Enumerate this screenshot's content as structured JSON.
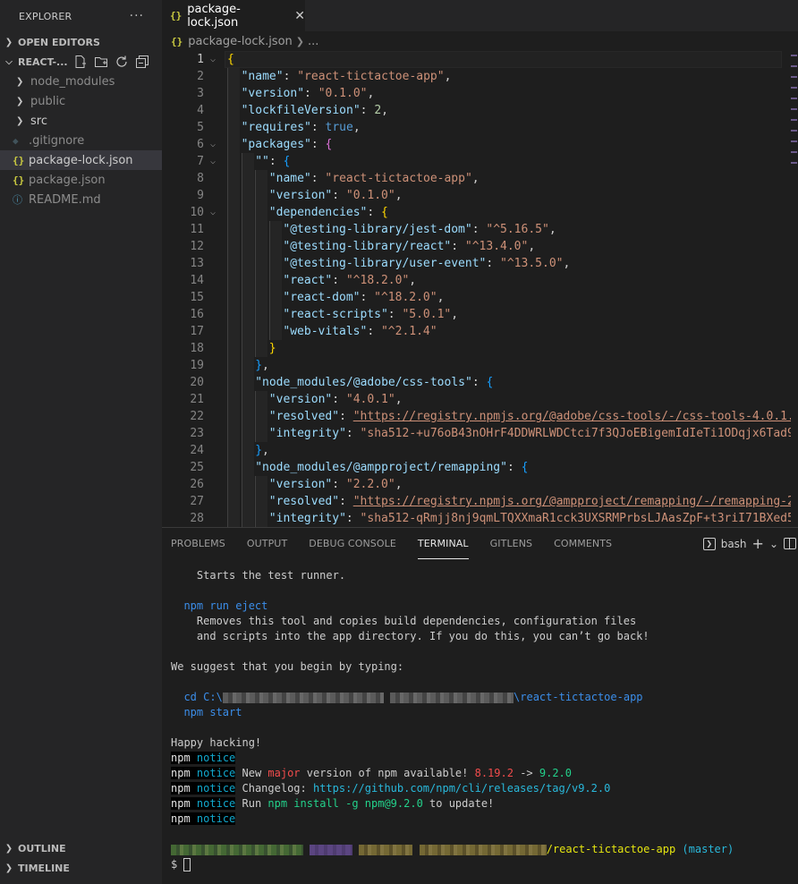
{
  "explorer": {
    "title": "EXPLORER",
    "more": "···",
    "open_editors": "OPEN EDITORS",
    "project": "REACT-...",
    "items": [
      {
        "label": "node_modules",
        "type": "folder"
      },
      {
        "label": "public",
        "type": "folder"
      },
      {
        "label": "src",
        "type": "folder"
      },
      {
        "label": ".gitignore",
        "type": "git"
      },
      {
        "label": "package-lock.json",
        "type": "json"
      },
      {
        "label": "package.json",
        "type": "json"
      },
      {
        "label": "README.md",
        "type": "info"
      }
    ],
    "outline": "OUTLINE",
    "timeline": "TIMELINE"
  },
  "editor": {
    "tab_label": "package-lock.json",
    "json_icon": "{}",
    "close_icon": "✕",
    "breadcrumb_file": "package-lock.json",
    "breadcrumb_more": "..."
  },
  "code_lines": [
    [
      [
        "p1",
        "{"
      ]
    ],
    [
      [
        "k",
        "\"name\""
      ],
      [
        "t",
        ": "
      ],
      [
        "s",
        "\"react-tictactoe-app\""
      ],
      [
        "t",
        ","
      ]
    ],
    [
      [
        "k",
        "\"version\""
      ],
      [
        "t",
        ": "
      ],
      [
        "s",
        "\"0.1.0\""
      ],
      [
        "t",
        ","
      ]
    ],
    [
      [
        "k",
        "\"lockfileVersion\""
      ],
      [
        "t",
        ": "
      ],
      [
        "n",
        "2"
      ],
      [
        "t",
        ","
      ]
    ],
    [
      [
        "k",
        "\"requires\""
      ],
      [
        "t",
        ": "
      ],
      [
        "b",
        "true"
      ],
      [
        "t",
        ","
      ]
    ],
    [
      [
        "k",
        "\"packages\""
      ],
      [
        "t",
        ": "
      ],
      [
        "p2",
        "{"
      ]
    ],
    [
      [
        "k",
        "\"\""
      ],
      [
        "t",
        ": "
      ],
      [
        "p3",
        "{"
      ]
    ],
    [
      [
        "k",
        "\"name\""
      ],
      [
        "t",
        ": "
      ],
      [
        "s",
        "\"react-tictactoe-app\""
      ],
      [
        "t",
        ","
      ]
    ],
    [
      [
        "k",
        "\"version\""
      ],
      [
        "t",
        ": "
      ],
      [
        "s",
        "\"0.1.0\""
      ],
      [
        "t",
        ","
      ]
    ],
    [
      [
        "k",
        "\"dependencies\""
      ],
      [
        "t",
        ": "
      ],
      [
        "p1",
        "{"
      ]
    ],
    [
      [
        "k",
        "\"@testing-library/jest-dom\""
      ],
      [
        "t",
        ": "
      ],
      [
        "s",
        "\"^5.16.5\""
      ],
      [
        "t",
        ","
      ]
    ],
    [
      [
        "k",
        "\"@testing-library/react\""
      ],
      [
        "t",
        ": "
      ],
      [
        "s",
        "\"^13.4.0\""
      ],
      [
        "t",
        ","
      ]
    ],
    [
      [
        "k",
        "\"@testing-library/user-event\""
      ],
      [
        "t",
        ": "
      ],
      [
        "s",
        "\"^13.5.0\""
      ],
      [
        "t",
        ","
      ]
    ],
    [
      [
        "k",
        "\"react\""
      ],
      [
        "t",
        ": "
      ],
      [
        "s",
        "\"^18.2.0\""
      ],
      [
        "t",
        ","
      ]
    ],
    [
      [
        "k",
        "\"react-dom\""
      ],
      [
        "t",
        ": "
      ],
      [
        "s",
        "\"^18.2.0\""
      ],
      [
        "t",
        ","
      ]
    ],
    [
      [
        "k",
        "\"react-scripts\""
      ],
      [
        "t",
        ": "
      ],
      [
        "s",
        "\"5.0.1\""
      ],
      [
        "t",
        ","
      ]
    ],
    [
      [
        "k",
        "\"web-vitals\""
      ],
      [
        "t",
        ": "
      ],
      [
        "s",
        "\"^2.1.4\""
      ]
    ],
    [
      [
        "p1",
        "}"
      ]
    ],
    [
      [
        "p3",
        "}"
      ],
      [
        "t",
        ","
      ]
    ],
    [
      [
        "k",
        "\"node_modules/@adobe/css-tools\""
      ],
      [
        "t",
        ": "
      ],
      [
        "p3",
        "{"
      ]
    ],
    [
      [
        "k",
        "\"version\""
      ],
      [
        "t",
        ": "
      ],
      [
        "s",
        "\"4.0.1\""
      ],
      [
        "t",
        ","
      ]
    ],
    [
      [
        "k",
        "\"resolved\""
      ],
      [
        "t",
        ": "
      ],
      [
        "u",
        "\"https://registry.npmjs.org/@adobe/css-tools/-/css-tools-4.0.1."
      ]
    ],
    [
      [
        "k",
        "\"integrity\""
      ],
      [
        "t",
        ": "
      ],
      [
        "s",
        "\"sha512-+u76oB43nOHrF4DDWRLWDCtci7f3QJoEBigemIdIeTi1ODqjx6Tad9"
      ]
    ],
    [
      [
        "p3",
        "}"
      ],
      [
        "t",
        ","
      ]
    ],
    [
      [
        "k",
        "\"node_modules/@ampproject/remapping\""
      ],
      [
        "t",
        ": "
      ],
      [
        "p3",
        "{"
      ]
    ],
    [
      [
        "k",
        "\"version\""
      ],
      [
        "t",
        ": "
      ],
      [
        "s",
        "\"2.2.0\""
      ],
      [
        "t",
        ","
      ]
    ],
    [
      [
        "k",
        "\"resolved\""
      ],
      [
        "t",
        ": "
      ],
      [
        "u",
        "\"https://registry.npmjs.org/@ampproject/remapping/-/remapping-2"
      ]
    ],
    [
      [
        "k",
        "\"integrity\""
      ],
      [
        "t",
        ": "
      ],
      [
        "s",
        "\"sha512-qRmjj8nj9qmLTQXXmaR1cck3UXSRMPrbsLJAasZpF+t3riI71BXed5"
      ]
    ]
  ],
  "panel": {
    "tabs": [
      "PROBLEMS",
      "OUTPUT",
      "DEBUG CONSOLE",
      "TERMINAL",
      "GITLENS",
      "COMMENTS"
    ],
    "active_tab": "TERMINAL",
    "shell": "bash",
    "add": "+",
    "dropdown": "⌄"
  },
  "terminal": {
    "l1": "    Starts the test runner.",
    "l2_cmd": "  npm run eject",
    "l3": "    Removes this tool and copies build dependencies, configuration files",
    "l4": "    and scripts into the app directory. If you do this, you can’t go back!",
    "l5": "We suggest that you begin by typing:",
    "l6_prefix": "  cd C:\\",
    "l6_suffix": "\\react-tictactoe-app",
    "l7": "  npm start",
    "l8": "Happy hacking!",
    "npm": "npm",
    "notice": "notice",
    "n2_a": " New ",
    "n2_major": "major",
    "n2_b": " version of npm available! ",
    "n2_old": "8.19.2",
    "n2_arrow": " -> ",
    "n2_new": "9.2.0",
    "n3_a": " Changelog: ",
    "n3_link": "https://github.com/npm/cli/releases/tag/v9.2.0",
    "n4_a": " Run ",
    "n4_cmd": "npm install -g npm@9.2.0",
    "n4_b": " to update!",
    "prompt_path": "/react-tictactoe-app",
    "prompt_branch": " (master)",
    "prompt": "$ "
  },
  "colors": {
    "accent": "#007acc",
    "string": "#ce9178",
    "key": "#9cdcfe",
    "json_icon": "#cbcb41"
  }
}
